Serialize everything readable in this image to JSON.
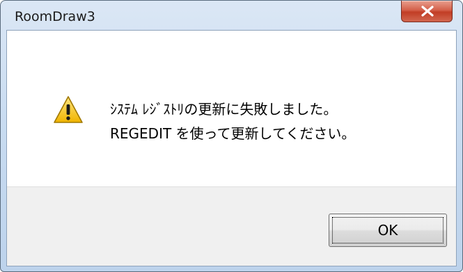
{
  "window": {
    "title": "RoomDraw3",
    "close_icon": "close-x-icon"
  },
  "dialog": {
    "icon": "warning-icon",
    "message_lines": [
      "ｼｽﾃﾑ ﾚｼﾞｽﾄﾘの更新に失敗しました。",
      "REGEDIT を使って更新してください。"
    ]
  },
  "buttons": {
    "ok_label": "OK"
  },
  "colors": {
    "titlebar": "#c9dcf1",
    "close_button": "#c94a33",
    "warning_fill": "#f5c200",
    "footer": "#f0f0f0"
  }
}
